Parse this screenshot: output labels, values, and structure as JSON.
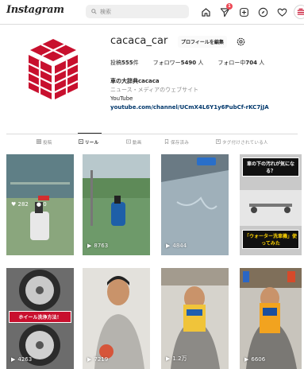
{
  "app": {
    "logo": "Instagram"
  },
  "search": {
    "placeholder": "検索"
  },
  "nav": {
    "notification_badge": "1"
  },
  "profile": {
    "username": "cacaca_car",
    "edit_label": "プロフィールを編集",
    "stats": [
      {
        "label": "投稿",
        "value": "555",
        "unit": "件"
      },
      {
        "label": "フォロワー",
        "value": "5490",
        "unit": "人"
      },
      {
        "label": "フォロー中",
        "value": "704",
        "unit": "人"
      }
    ],
    "bio": {
      "name": "車の大辞典cacaca",
      "category": "ニュース・メディアのウェブサイト",
      "platform": "YouTube",
      "link": "youtube.com/channel/UCmX4L6Y1y6PubCf-rKC7jJA"
    }
  },
  "tabs": [
    {
      "label": "投稿",
      "icon": "grid-icon"
    },
    {
      "label": "リール",
      "icon": "reels-icon"
    },
    {
      "label": "動画",
      "icon": "video-icon"
    },
    {
      "label": "保存済み",
      "icon": "bookmark-icon"
    },
    {
      "label": "タグ付けされている人",
      "icon": "tag-icon"
    }
  ],
  "grid": [
    {
      "likes": "282",
      "comments": "0"
    },
    {
      "views": "8763"
    },
    {
      "views": "4844"
    },
    {
      "top_text": "車の下の汚れが気になる？",
      "bottom_text": "「ウォーター洗車機」使ってみた"
    },
    {
      "views": "4263",
      "banner": "ホイール洗浄方法！"
    },
    {
      "views": "7219"
    },
    {
      "views": "1.2万"
    },
    {
      "views": "6606"
    }
  ],
  "colors": {
    "brand_red": "#c8102e",
    "link": "#00376b",
    "badge": "#ed4956"
  }
}
